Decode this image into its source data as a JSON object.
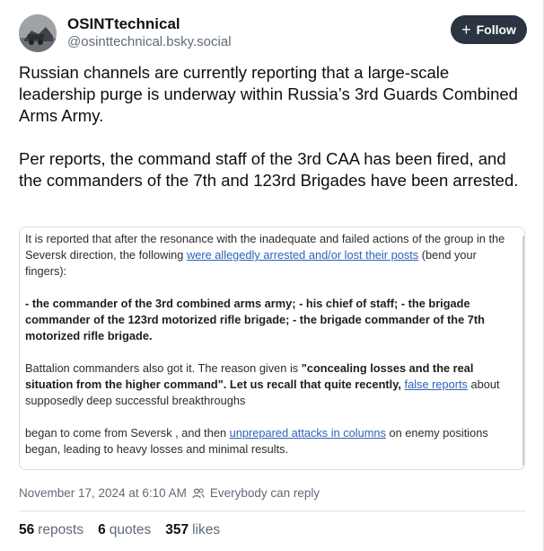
{
  "author": {
    "name": "OSINTtechnical",
    "handle": "@osinttechnical.bsky.social"
  },
  "follow_button": {
    "label": "Follow",
    "icon": "plus-icon"
  },
  "post": {
    "paragraph_1": "Russian channels are currently reporting that a large-scale leadership purge is underway within Russia’s 3rd Guards Combined Arms Army.",
    "paragraph_2": "Per reports, the command staff of the 3rd CAA has been fired, and the commanders of the 7th and 123rd Brigades have been arrested."
  },
  "embedded_image": {
    "p1_before": "It is reported that after the resonance with the inadequate and failed actions of the group in the Seversk direction, the following ",
    "p1_link": "were allegedly arrested and/or lost their posts",
    "p1_after": " (bend your fingers):",
    "p2": " - the commander of the 3rd combined arms army; - his chief of staff; - the brigade commander of the 123rd motorized rifle brigade; - the brigade commander of the 7th motorized rifle brigade.",
    "p3_before": "Battalion commanders also got it. The reason given is ",
    "p3_bold": "\"concealing losses and the real situation from the higher command\". Let us recall that quite recently,",
    "p3_space": " ",
    "p3_link": "false reports",
    "p3_after": " about supposedly deep successful breakthroughs",
    "p4_before": "began to come from Seversk , and then ",
    "p4_link": "unprepared attacks in columns",
    "p4_after": " on enemy positions began, leading to heavy losses and minimal results."
  },
  "meta": {
    "timestamp": "November 17, 2024 at 6:10 AM",
    "reply_setting": "Everybody can reply"
  },
  "stats": {
    "reposts_count": "56",
    "reposts_label": "reposts",
    "quotes_count": "6",
    "quotes_label": "quotes",
    "likes_count": "357",
    "likes_label": "likes"
  },
  "colors": {
    "follow_bg": "#2b3440",
    "link": "#2e62b8",
    "muted": "#5f6b78"
  }
}
